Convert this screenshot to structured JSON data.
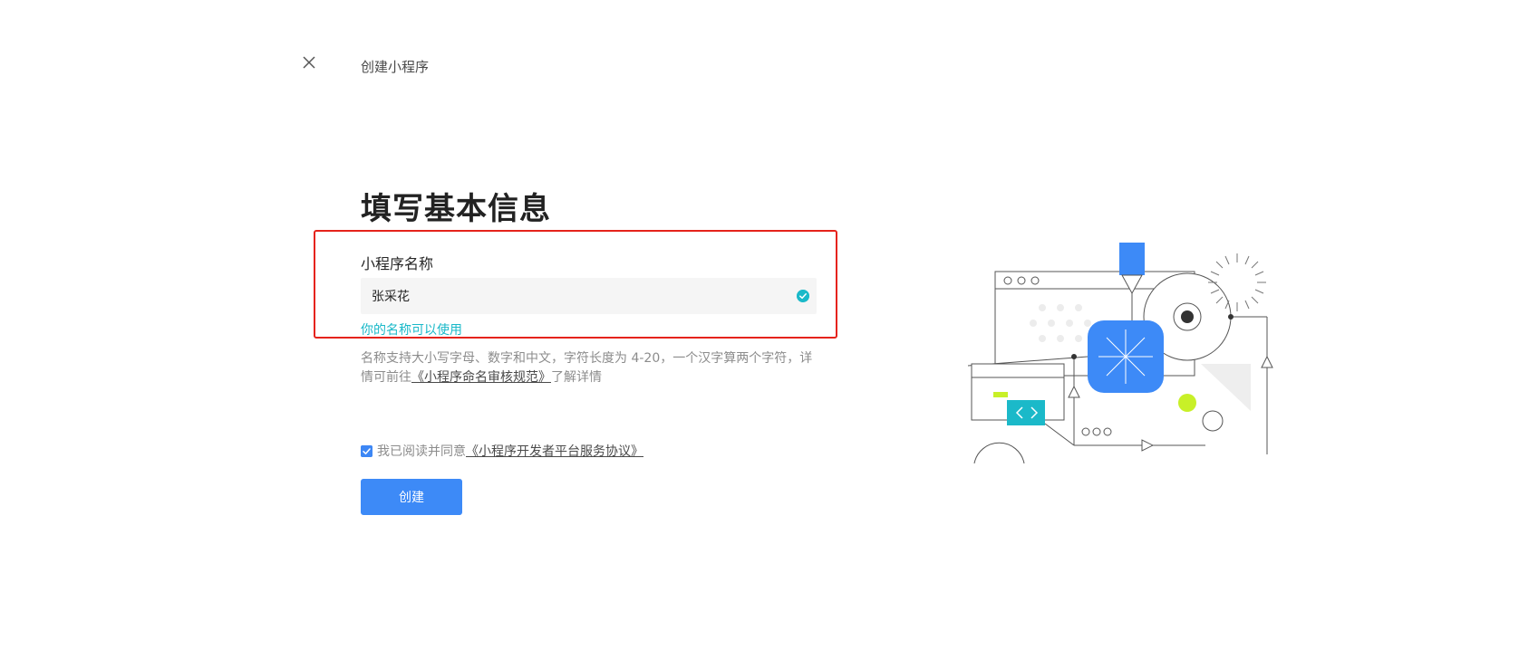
{
  "header": {
    "close_icon": "close-icon",
    "title": "创建小程序"
  },
  "main": {
    "title": "填写基本信息",
    "name_field": {
      "label": "小程序名称",
      "value": "张采花",
      "status_icon": "check-circle-icon",
      "valid_message": "你的名称可以使用"
    },
    "hint": {
      "text_before": "名称支持大小写字母、数字和中文，字符长度为 4-20，一个汉字算两个字符，详情可前往",
      "link_text": "《小程序命名审核规范》",
      "text_after": "了解详情"
    },
    "agreement": {
      "checked": true,
      "text": "我已阅读并同意",
      "link_text": "《小程序开发者平台服务协议》"
    },
    "create_button": "创建"
  },
  "colors": {
    "accent": "#3d8af7",
    "success": "#1bb9c9",
    "highlight_border": "#e5231b",
    "lime": "#c8f028"
  }
}
